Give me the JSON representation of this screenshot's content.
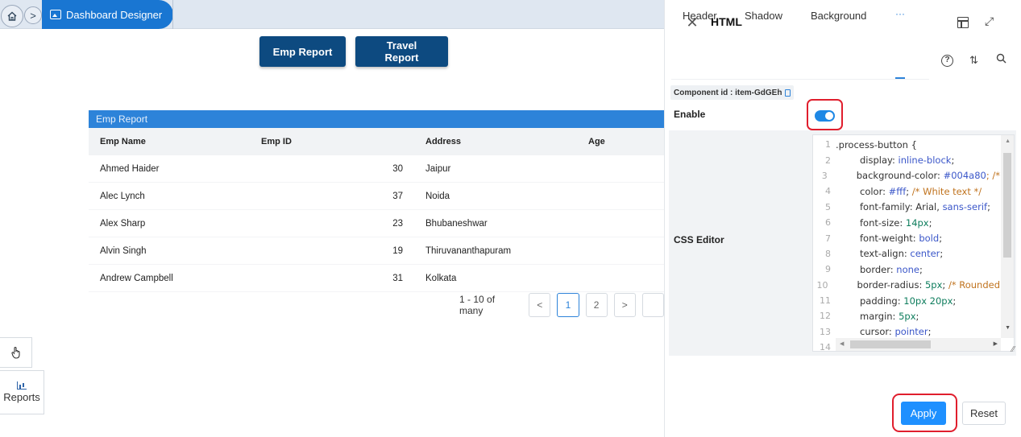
{
  "breadcrumb": {
    "home_icon": "home-icon",
    "separator": ">",
    "current": "Dashboard Designer",
    "current_icon": "image-icon"
  },
  "buttons": {
    "emp_report": "Emp Report",
    "travel_report": "Travel Report"
  },
  "table": {
    "title": "Emp Report",
    "columns": [
      "Emp Name",
      "Emp ID",
      "Address",
      "Age"
    ],
    "rows": [
      {
        "name": "Ahmed Haider",
        "id": "30",
        "address": "Jaipur"
      },
      {
        "name": "Alec Lynch",
        "id": "37",
        "address": "Noida"
      },
      {
        "name": "Alex Sharp",
        "id": "23",
        "address": "Bhubaneshwar"
      },
      {
        "name": "Alvin Singh",
        "id": "19",
        "address": "Thiruvananthapuram"
      },
      {
        "name": "Andrew Campbell",
        "id": "31",
        "address": "Kolkata"
      }
    ]
  },
  "pager": {
    "range": "1 - 10 of many",
    "prev": "<",
    "pages": [
      "1",
      "2"
    ],
    "next": ">",
    "active_page": "1"
  },
  "tools": {
    "reports_label": "Reports",
    "hand_icon": "hand-pointer-icon",
    "reports_icon": "bar-chart-icon"
  },
  "panel": {
    "title": "HTML",
    "tabs": [
      "Header",
      "Shadow",
      "Background",
      "···"
    ],
    "component_id": "Component id : item-GdGEh",
    "enable_label": "Enable",
    "enable_on": true,
    "css_label": "CSS Editor",
    "apply": "Apply",
    "reset": "Reset",
    "code_lines": [
      {
        "n": "1",
        "parts": [
          {
            "t": ".process-button {",
            "c": "code"
          }
        ]
      },
      {
        "n": "2",
        "parts": [
          {
            "t": "display: ",
            "c": "code"
          },
          {
            "t": "inline-block",
            "c": "kw"
          },
          {
            "t": ";",
            "c": "code"
          }
        ]
      },
      {
        "n": "3",
        "parts": [
          {
            "t": "background-color: ",
            "c": "code"
          },
          {
            "t": "#004a80",
            "c": "hex"
          },
          {
            "t": "; /*",
            "c": "cm"
          }
        ]
      },
      {
        "n": "4",
        "parts": [
          {
            "t": "color: ",
            "c": "code"
          },
          {
            "t": "#fff",
            "c": "hex"
          },
          {
            "t": "; ",
            "c": "code"
          },
          {
            "t": "/* White text */",
            "c": "cm"
          }
        ]
      },
      {
        "n": "5",
        "parts": [
          {
            "t": "font-family: Arial, ",
            "c": "code"
          },
          {
            "t": "sans-serif",
            "c": "kw"
          },
          {
            "t": ";",
            "c": "code"
          }
        ]
      },
      {
        "n": "6",
        "parts": [
          {
            "t": "font-size: ",
            "c": "code"
          },
          {
            "t": "14px",
            "c": "num"
          },
          {
            "t": ";",
            "c": "code"
          }
        ]
      },
      {
        "n": "7",
        "parts": [
          {
            "t": "font-weight: ",
            "c": "code"
          },
          {
            "t": "bold",
            "c": "kw"
          },
          {
            "t": ";",
            "c": "code"
          }
        ]
      },
      {
        "n": "8",
        "parts": [
          {
            "t": "text-align: ",
            "c": "code"
          },
          {
            "t": "center",
            "c": "kw"
          },
          {
            "t": ";",
            "c": "code"
          }
        ]
      },
      {
        "n": "9",
        "parts": [
          {
            "t": "border: ",
            "c": "code"
          },
          {
            "t": "none",
            "c": "kw"
          },
          {
            "t": ";",
            "c": "code"
          }
        ]
      },
      {
        "n": "10",
        "parts": [
          {
            "t": "border-radius: ",
            "c": "code"
          },
          {
            "t": "5px",
            "c": "num"
          },
          {
            "t": "; ",
            "c": "code"
          },
          {
            "t": "/* Rounded",
            "c": "cm"
          }
        ]
      },
      {
        "n": "11",
        "parts": [
          {
            "t": "padding: ",
            "c": "code"
          },
          {
            "t": "10px 20px",
            "c": "num"
          },
          {
            "t": ";",
            "c": "code"
          }
        ]
      },
      {
        "n": "12",
        "parts": [
          {
            "t": "margin: ",
            "c": "code"
          },
          {
            "t": "5px",
            "c": "num"
          },
          {
            "t": ";",
            "c": "code"
          }
        ]
      },
      {
        "n": "13",
        "parts": [
          {
            "t": "cursor: ",
            "c": "code"
          },
          {
            "t": "pointer",
            "c": "kw"
          },
          {
            "t": ";",
            "c": "code"
          }
        ]
      },
      {
        "n": "14",
        "parts": []
      }
    ]
  },
  "colors": {
    "accent": "#1e90ff",
    "report_button": "#0d4a80",
    "table_header_bar": "#2d83d9",
    "highlight": "#e01e2d"
  }
}
